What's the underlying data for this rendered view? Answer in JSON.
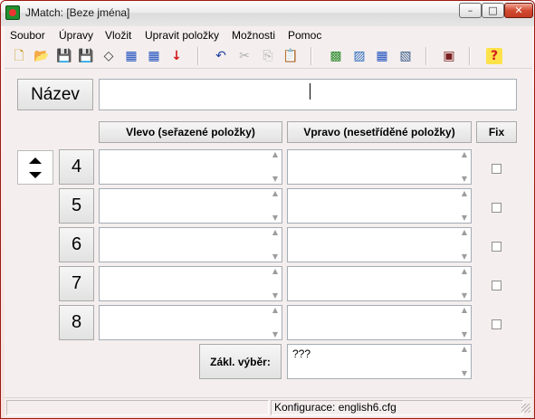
{
  "window": {
    "title": "JMatch: [Beze jména]",
    "controls": {
      "minimize": "–",
      "maximize": "□",
      "close": "✕"
    }
  },
  "menu": [
    "Soubor",
    "Úpravy",
    "Vložit",
    "Upravit položky",
    "Možnosti",
    "Pomoc"
  ],
  "toolbar": {
    "icons": [
      "new-file-icon",
      "open-folder-icon",
      "save-icon",
      "save-as-icon",
      "clear-icon",
      "web-page-icon",
      "web-page-alt-icon",
      "export-arrow-icon",
      "undo-icon",
      "cut-icon",
      "copy-icon",
      "paste-icon",
      "config-icon",
      "image-icon",
      "link-icon",
      "drag-icon",
      "monitor-icon",
      "help-icon"
    ],
    "glyphs": [
      "🗋",
      "📂",
      "💾",
      "💾",
      "◇",
      "▦",
      "▦",
      "↓",
      "↶",
      "✂",
      "⎘",
      "📋",
      "▩",
      "▨",
      "▦",
      "▧",
      "▣",
      "?"
    ]
  },
  "form": {
    "title_label": "Název",
    "title_value": "",
    "col_left": "Vlevo (seřazené položky)",
    "col_right": "Vpravo (nesetříděné položky)",
    "col_fix": "Fix",
    "rows": [
      {
        "number": "4",
        "left": "",
        "right": "",
        "fix": false
      },
      {
        "number": "5",
        "left": "",
        "right": "",
        "fix": false
      },
      {
        "number": "6",
        "left": "",
        "right": "",
        "fix": false
      },
      {
        "number": "7",
        "left": "",
        "right": "",
        "fix": false
      },
      {
        "number": "8",
        "left": "",
        "right": "",
        "fix": false
      }
    ],
    "default_label": "Zákl. výběr:",
    "default_value": "???"
  },
  "status": {
    "config": "Konfigurace: english6.cfg"
  },
  "colors": {
    "window_frame": "#9b1c14",
    "close_button": "#d34b31",
    "panel_bg": "#f4efee"
  }
}
